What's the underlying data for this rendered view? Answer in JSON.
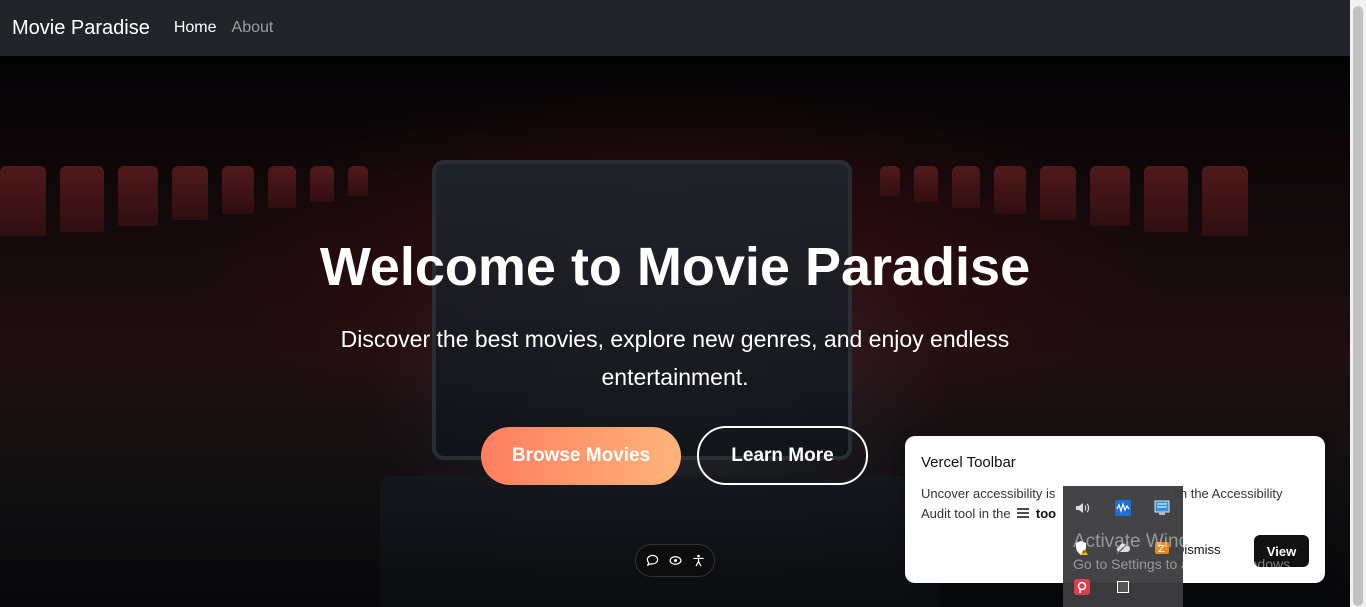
{
  "navbar": {
    "brand": "Movie Paradise",
    "links": [
      {
        "label": "Home",
        "active": true
      },
      {
        "label": "About",
        "active": false
      }
    ]
  },
  "hero": {
    "title": "Welcome to Movie Paradise",
    "subtitle": "Discover the best movies, explore new genres, and enjoy endless entertainment.",
    "primary_button": "Browse Movies",
    "secondary_button": "Learn More"
  },
  "mini_toolbar": {
    "icons": [
      "comment-icon",
      "eye-icon",
      "accessibility-icon"
    ]
  },
  "toast": {
    "title": "Vercel Toolbar",
    "body_before": "Uncover accessibility is",
    "body_after_hidden": "ith the Accessibility",
    "body_line2": "Audit tool in the",
    "body_bold": "too",
    "dismiss": "Dismiss",
    "view": "View"
  },
  "system_tray": {
    "icons": [
      "speaker-icon",
      "audio-wave-icon",
      "network-monitor-icon",
      "security-warning-icon",
      "cloud-icon",
      "app-tray-icon",
      "pocket-icon",
      "window-icon"
    ]
  },
  "watermark": {
    "title": "Activate Windows",
    "subtitle": "Go to Settings to activate Windows."
  },
  "colors": {
    "navbar_bg": "#212529",
    "primary_gradient_start": "#ff7e5f",
    "primary_gradient_end": "#feb47b"
  }
}
